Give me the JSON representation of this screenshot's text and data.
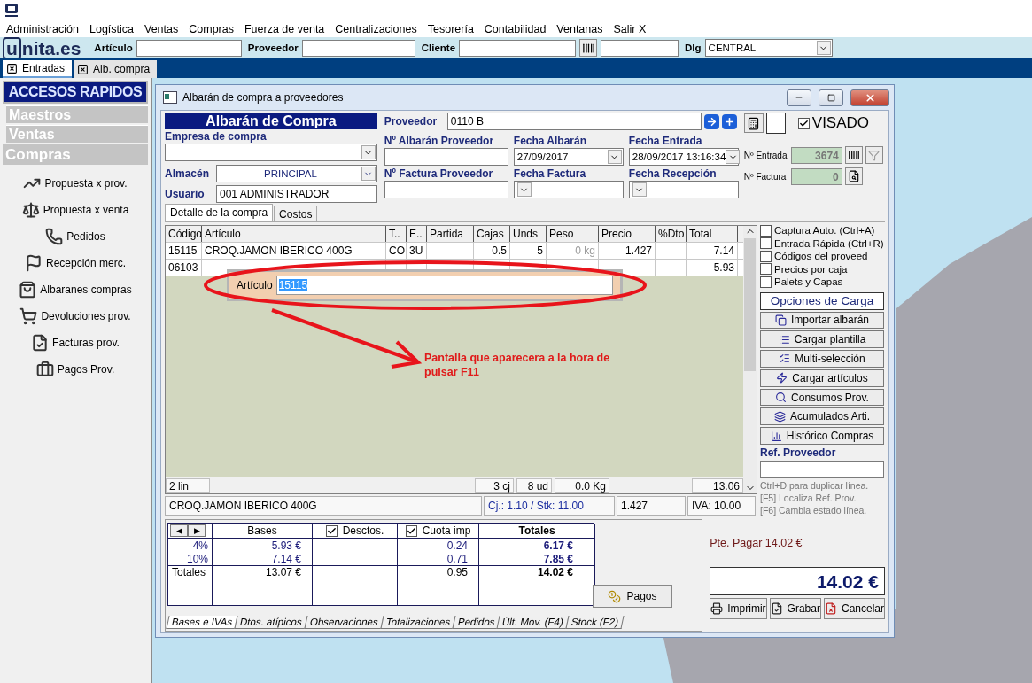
{
  "menu": [
    "Administración",
    "Logística",
    "Ventas",
    "Compras",
    "Fuerza de venta",
    "Centralizaciones",
    "Tesorería",
    "Contabilidad",
    "Ventanas",
    "Salir X"
  ],
  "toolbar": {
    "logo_mark": "u",
    "logo_text": "nita.es",
    "fields": [
      {
        "label": "Artículo"
      },
      {
        "label": "Proveedor"
      },
      {
        "label": "Cliente"
      }
    ],
    "dlg": {
      "label": "Dlg",
      "value": "CENTRAL"
    }
  },
  "window_tabs": [
    {
      "label": "Entradas",
      "selected": true
    },
    {
      "label": "Alb. compra",
      "selected": false
    }
  ],
  "sidebar": {
    "title": "ACCESOS RAPIDOS",
    "sections": [
      {
        "label": "Maestros",
        "expanded": false
      },
      {
        "label": "Ventas",
        "expanded": false
      },
      {
        "label": "Compras",
        "expanded": true
      }
    ],
    "items": [
      "Propuesta x prov.",
      "Propuesta x venta",
      "Pedidos",
      "Recepción merc.",
      "Albaranes compras",
      "Devoluciones prov.",
      "Facturas prov.",
      "Pagos Prov."
    ]
  },
  "dialog": {
    "title": "Albarán de compra a proveedores",
    "header": {
      "heading": "Albarán de Compra",
      "empresa": {
        "label": "Empresa de compra"
      },
      "almacen": {
        "label": "Almacén",
        "value": "PRINCIPAL"
      },
      "usuario": {
        "label": "Usuario",
        "value": "001 ADMINISTRADOR"
      },
      "proveedor": {
        "label": "Proveedor",
        "value": "0110 B"
      },
      "visado": {
        "label": "VISADO",
        "checked": true
      },
      "fields": [
        {
          "label": "Nº Albarán Proveedor",
          "kind": "text"
        },
        {
          "label": "Fecha Albarán",
          "kind": "combo",
          "value": "27/09/2017"
        },
        {
          "label": "Fecha Entrada",
          "kind": "combo",
          "value": "28/09/2017 13:16:34"
        },
        {
          "label": "Nº Factura Proveedor",
          "kind": "text"
        },
        {
          "label": "Fecha Factura",
          "kind": "combo"
        },
        {
          "label": "Fecha Recepción",
          "kind": "combo"
        }
      ],
      "n_entrada": {
        "label": "Nº Entrada",
        "value": "3674"
      },
      "n_factura": {
        "label": "Nº Factura",
        "value": "0"
      }
    },
    "detail_tabs": [
      {
        "label": "Detalle de la compra",
        "selected": true
      },
      {
        "label": "Costos",
        "selected": false
      }
    ],
    "table": {
      "columns": [
        "Código",
        "Artículo",
        "T..",
        "E..",
        "Partida",
        "Cajas",
        "Unds",
        "Peso",
        "Precio",
        "%Dto",
        "Total"
      ],
      "rows": [
        [
          "15115",
          "CROQ.JAMON IBERICO 400G",
          "CO",
          "3U",
          "",
          "0.5",
          "5",
          "0 kg",
          "1.427",
          "",
          "7.14"
        ],
        [
          "06103",
          null,
          null,
          null,
          null,
          null,
          null,
          null,
          null,
          null,
          "5.93"
        ]
      ],
      "footer": {
        "lines": "2 lin",
        "cajas": "3 cj",
        "unds": "8 ud",
        "peso": "0.0 Kg",
        "total": "13.06"
      },
      "status": {
        "article": "CROQ.JAMON IBERICO 400G",
        "stock": "Cj.: 1.10 / Stk: 11.00",
        "price": "1.427",
        "iva": "IVA: 10.00"
      }
    },
    "popup": {
      "label": "Artículo",
      "value": "15115"
    },
    "annotation": "Pantalla que aparecera a la hora de pulsar F11",
    "options": [
      {
        "label": "Captura Auto. (Ctrl+A)",
        "checked": false
      },
      {
        "label": "Entrada Rápida (Ctrl+R)",
        "checked": false
      },
      {
        "label": "Códigos del proveed",
        "checked": false
      },
      {
        "label": "Precios por caja",
        "checked": false
      },
      {
        "label": "Palets y Capas",
        "checked": false
      }
    ],
    "load_title": "Opciones de Carga",
    "load_buttons": [
      "Importar albarán",
      "Cargar plantilla",
      "Multi-selección",
      "Cargar artículos",
      "Consumos Prov.",
      "Acumulados Arti.",
      "Histórico Compras"
    ],
    "ref": {
      "label": "Ref. Proveedor"
    },
    "hints": [
      "Ctrl+D para duplicar línea.",
      "[F5] Localiza Ref. Prov.",
      "[F6] Cambia estado línea."
    ],
    "totals": {
      "nav": [
        "◀",
        "▶"
      ],
      "headers": [
        {
          "label": "Bases"
        },
        {
          "label": "Desctos.",
          "checked": true
        },
        {
          "label": "Cuota imp",
          "checked": true
        },
        {
          "label": "Totales"
        }
      ],
      "rows": [
        {
          "kind": "rate",
          "label": "4%",
          "base": "5.93 €",
          "cuota": "0.24",
          "total": "6.17 €"
        },
        {
          "kind": "rate",
          "label": "10%",
          "base": "7.14 €",
          "cuota": "0.71",
          "total": "7.85 €"
        },
        {
          "kind": "sum",
          "label": "Totales",
          "base": "13.07 €",
          "cuota": "0.95",
          "total": "14.02 €"
        }
      ]
    },
    "pagos_button": "Pagos",
    "bottom_tabs": [
      {
        "label": "Bases e IVAs",
        "selected": true
      },
      {
        "label": "Dtos. atípicos",
        "selected": false
      },
      {
        "label": "Observaciones",
        "selected": false
      },
      {
        "label": "Totalizaciones",
        "selected": false
      },
      {
        "label": "Pedidos",
        "selected": false
      },
      {
        "label": "Últ. Mov. (F4)",
        "selected": false
      },
      {
        "label": "Stock (F2)",
        "selected": false
      }
    ],
    "pending": "Pte. Pagar 14.02 €",
    "grand_total": "14.02 €",
    "actions": [
      "Imprimir",
      "Grabar",
      "Cancelar"
    ]
  }
}
